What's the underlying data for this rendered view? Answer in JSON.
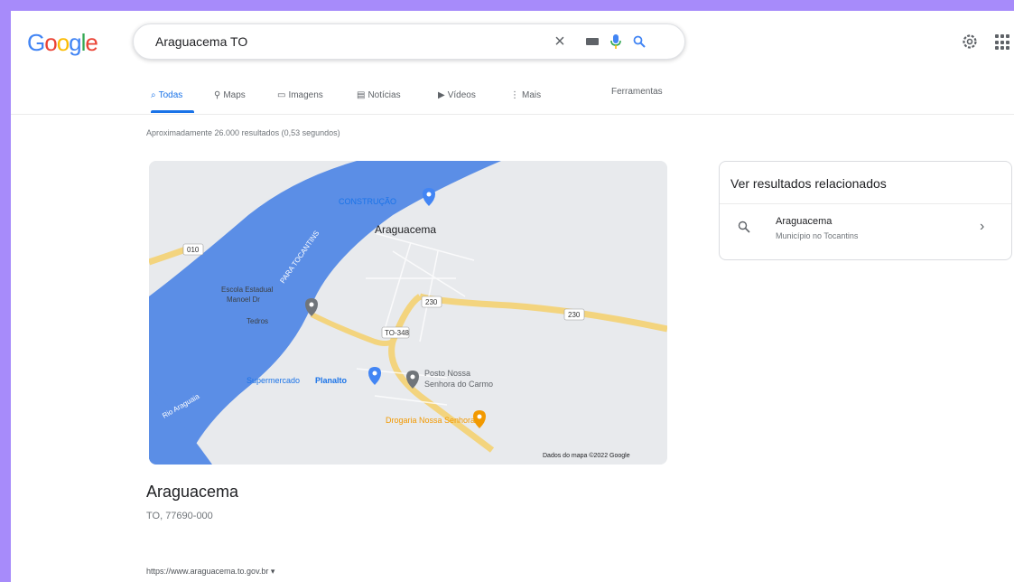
{
  "logo": {
    "letters": [
      "G",
      "o",
      "o",
      "g",
      "l",
      "e"
    ],
    "colors": [
      "#4285f4",
      "#ea4335",
      "#fbbc05",
      "#4285f4",
      "#34a853",
      "#ea4335"
    ]
  },
  "search": {
    "query": "Araguacema TO"
  },
  "icons": {
    "clear": "close-icon",
    "keyboard": "keyboard-icon",
    "mic": "mic-icon",
    "lens": "search-icon",
    "settings": "gear-icon",
    "apps": "apps-icon"
  },
  "tabs": [
    {
      "label": "Todas",
      "icon": "search-icon"
    },
    {
      "label": "Maps",
      "icon": "map-pin-icon"
    },
    {
      "label": "Imagens",
      "icon": "image-icon"
    },
    {
      "label": "Notícias",
      "icon": "news-icon"
    },
    {
      "label": "Vídeos",
      "icon": "video-icon"
    },
    {
      "label": "Mais",
      "icon": "more-icon"
    }
  ],
  "tools_label": "Ferramentas",
  "stats": "Aproximadamente 26.000 resultados (0,53 segundos)",
  "map": {
    "labels": {
      "town": "Araguacema",
      "construction": "CONSTRUÇÃO",
      "river_road": "PARA TOCANTINS",
      "school": "Escola Estadual",
      "school_line2": "Manoel Dr",
      "school_line3": "Tedros",
      "supermarket": "Supermercado",
      "supermarket_bold": "Planalto",
      "gas_station": "Posto Nossa",
      "gas_station_line2": "Senhora do Carmo",
      "pharmacy": "Drogaria Nossa Senhora",
      "river": "Rio Araguaia",
      "road1": "010",
      "road2": "230",
      "road3": "TO-348",
      "road4": "230",
      "copyright": "Dados do mapa ©2022 Google"
    },
    "colors": {
      "water": "#5b8ee6",
      "land": "#e8eaed",
      "road": "#f3d47e",
      "pin_blue": "#4285f4",
      "pin_gray": "#70757a",
      "pin_orange": "#f29900"
    }
  },
  "place": {
    "title": "Araguacema",
    "address": "TO, 77690-000"
  },
  "result_url": "https://www.araguacema.to.gov.br",
  "related": {
    "heading": "Ver resultados relacionados",
    "items": [
      {
        "title": "Araguacema",
        "subtitle": "Município no Tocantins"
      }
    ]
  }
}
